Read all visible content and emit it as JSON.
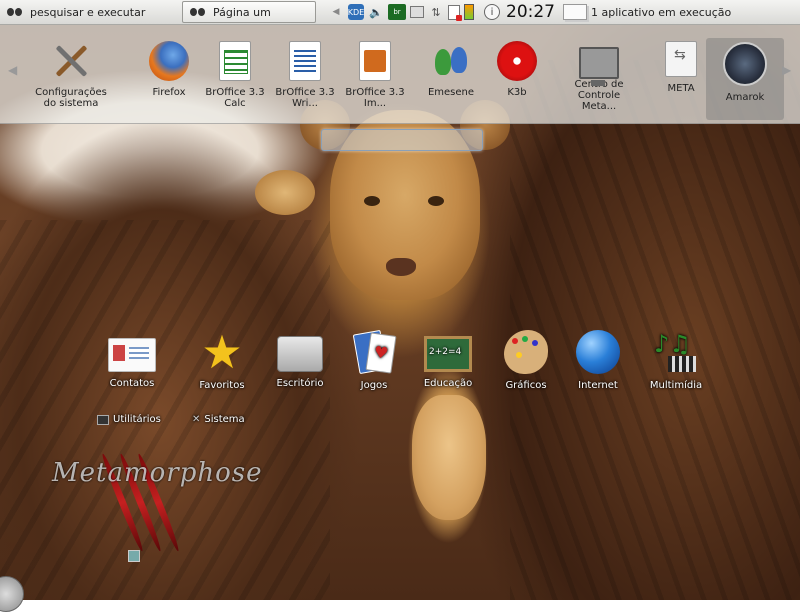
{
  "top_panel": {
    "search_label": "pesquisar e executar",
    "page_label": "Página um",
    "tray_br_text": "br",
    "tray_kde_text": "KDE",
    "info_glyph": "i",
    "clock": "20:27",
    "task_label": "1 aplicativo em execução"
  },
  "launcher": {
    "apps": [
      {
        "label": "Configurações do sistema",
        "icon": "tools-icon"
      },
      {
        "label": "Firefox",
        "icon": "firefox-icon"
      },
      {
        "label": "BrOffice 3.3 Calc",
        "icon": "calc-icon"
      },
      {
        "label": "BrOffice 3.3 Wri...",
        "icon": "writer-icon"
      },
      {
        "label": "BrOffice 3.3 Im...",
        "icon": "impress-icon"
      },
      {
        "label": "Emesene",
        "icon": "emesene-icon"
      },
      {
        "label": "K3b",
        "icon": "k3b-icon"
      },
      {
        "label": "Centro de Controle Meta...",
        "icon": "control-center-icon"
      },
      {
        "label": "META",
        "icon": "usb-drive-icon"
      },
      {
        "label": "Amarok",
        "icon": "amarok-icon"
      }
    ],
    "left_arrow": "◀",
    "right_arrow": "▶"
  },
  "search_field": {
    "placeholder": ""
  },
  "categories": [
    {
      "label": "Contatos",
      "icon": "contacts-icon"
    },
    {
      "label": "Favoritos",
      "icon": "star-icon"
    },
    {
      "label": "Escritório",
      "icon": "fax-icon"
    },
    {
      "label": "Jogos",
      "icon": "cards-icon"
    },
    {
      "label": "Educação",
      "icon": "chalkboard-icon"
    },
    {
      "label": "Gráficos",
      "icon": "palette-icon"
    },
    {
      "label": "Internet",
      "icon": "globe-icon"
    },
    {
      "label": "Multimídia",
      "icon": "multimedia-icon"
    }
  ],
  "shortcuts": {
    "utilities": "Utilitários",
    "system": "Sistema"
  },
  "logo_text": "Metamorphose",
  "colors": {
    "panel_bg": "#e6e6e3",
    "launcher_bg": "#ebebe8",
    "label_light": "#ffffff"
  }
}
